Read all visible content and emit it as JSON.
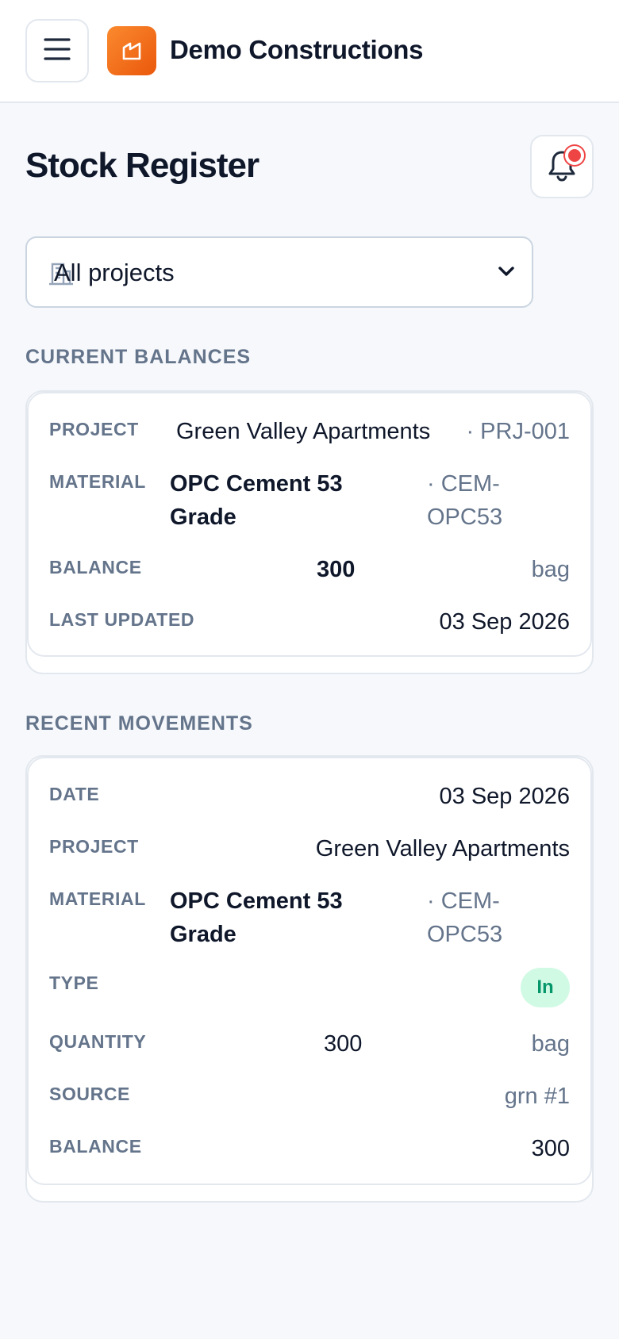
{
  "header": {
    "brand_name": "Demo Constructions",
    "menu_icon": "hamburger-menu-icon",
    "logo_icon": "building-logo-icon",
    "accent": "#f97316"
  },
  "page": {
    "title": "Stock Register",
    "notification_icon": "bell-icon",
    "notification_dot_color": "#ef4444"
  },
  "filter": {
    "project_select_value": "All projects",
    "project_icon": "building-icon"
  },
  "current_balances": {
    "section_title": "CURRENT BALANCES",
    "card": {
      "project_label": "PROJECT",
      "project_name": "Green Valley Apartments",
      "project_code": "· PRJ-001",
      "material_label": "MATERIAL",
      "material_name_line1": "OPC Cement 53",
      "material_name_line2": "Grade",
      "material_code_line1": "· CEM-",
      "material_code_line2": "OPC53",
      "balance_label": "BALANCE",
      "balance_value": "300",
      "balance_unit": "bag",
      "last_updated_label": "LAST UPDATED",
      "last_updated_value": "03 Sep 2026"
    }
  },
  "recent_movements": {
    "section_title": "RECENT MOVEMENTS",
    "card": {
      "date_label": "DATE",
      "date_value": "03 Sep 2026",
      "project_label": "PROJECT",
      "project_name": "Green Valley Apartments",
      "material_label": "MATERIAL",
      "material_name_line1": "OPC Cement 53",
      "material_name_line2": "Grade",
      "material_code_line1": "· CEM-",
      "material_code_line2": "OPC53",
      "type_label": "TYPE",
      "type_value": "In",
      "quantity_label": "QUANTITY",
      "quantity_value": "300",
      "quantity_unit": "bag",
      "source_label": "SOURCE",
      "source_value": "grn #1",
      "balance_label": "BALANCE",
      "balance_value": "300"
    }
  }
}
